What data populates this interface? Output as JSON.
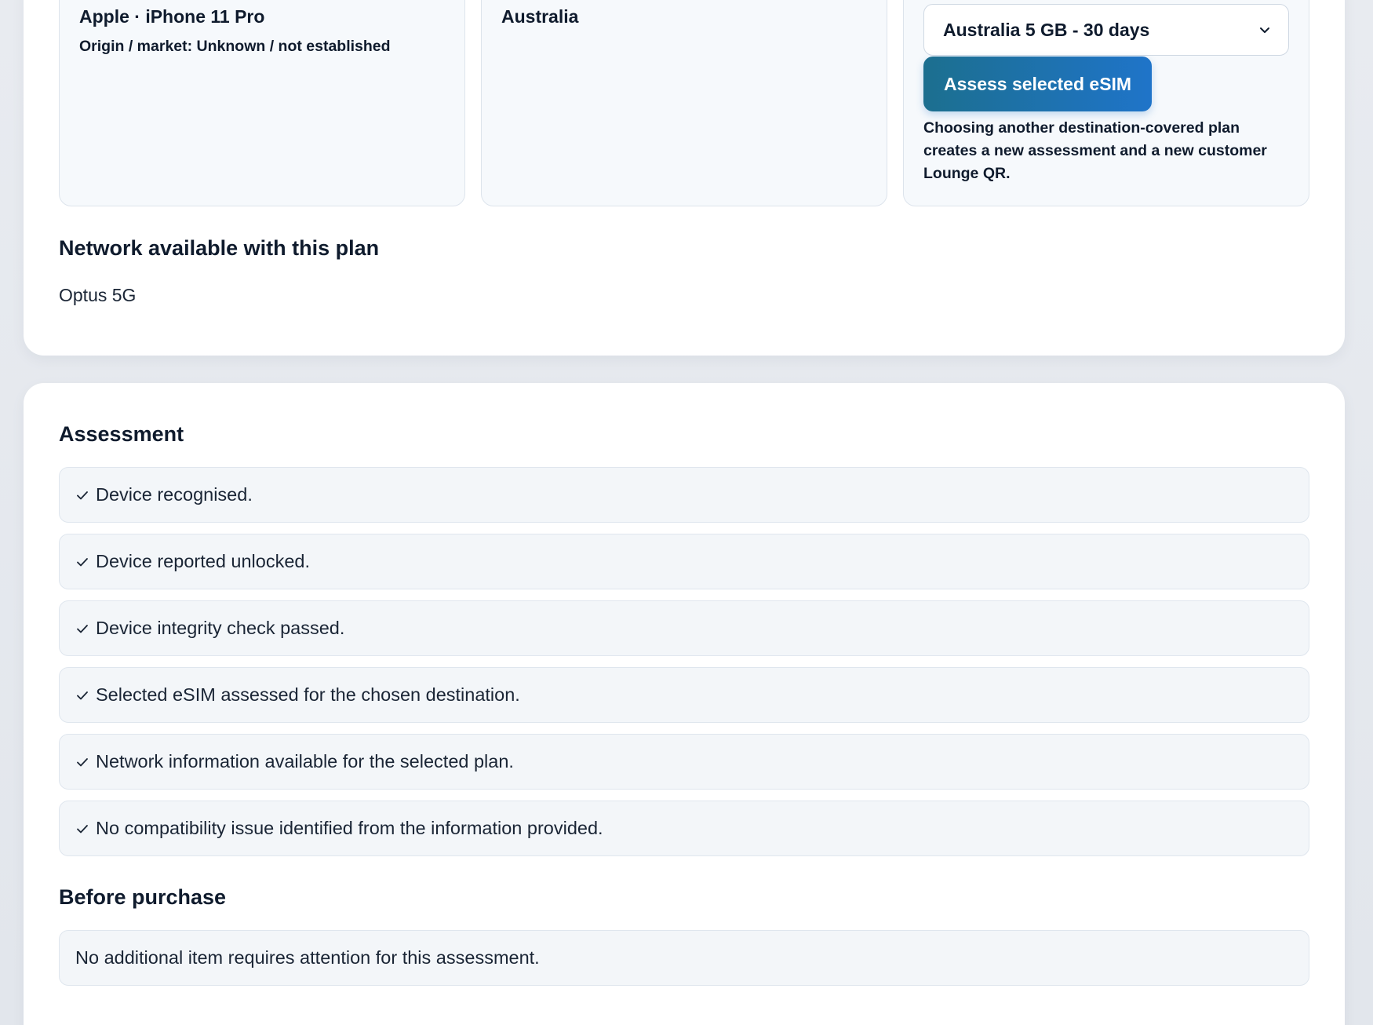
{
  "device": {
    "title": "Apple · iPhone 11 Pro",
    "origin": "Origin / market: Unknown / not established"
  },
  "destination": {
    "title": "Australia"
  },
  "plan": {
    "selected": "Australia 5 GB - 30 days",
    "assess_button": "Assess selected eSIM",
    "note": "Choosing another destination-covered plan creates a new assessment and a new customer Lounge QR."
  },
  "network": {
    "heading": "Network available with this plan",
    "value": "Optus 5G"
  },
  "assessment": {
    "heading": "Assessment",
    "items": [
      {
        "text": "Device recognised."
      },
      {
        "text": "Device reported unlocked."
      },
      {
        "text": "Device integrity check passed."
      },
      {
        "text": "Selected eSIM assessed for the chosen destination."
      },
      {
        "text": "Network information available for the selected plan."
      },
      {
        "text": "No compatibility issue identified from the information provided."
      }
    ]
  },
  "before_purchase": {
    "heading": "Before purchase",
    "message": "No additional item requires attention for this assessment."
  },
  "icons": {
    "check": "check-icon",
    "chevron": "chevron-down-icon"
  },
  "colors": {
    "button_start": "#1c6f8f",
    "button_end": "#1f74c9",
    "background": "#e4e8ee",
    "card": "#ffffff",
    "row_bg": "#f3f6f9"
  }
}
